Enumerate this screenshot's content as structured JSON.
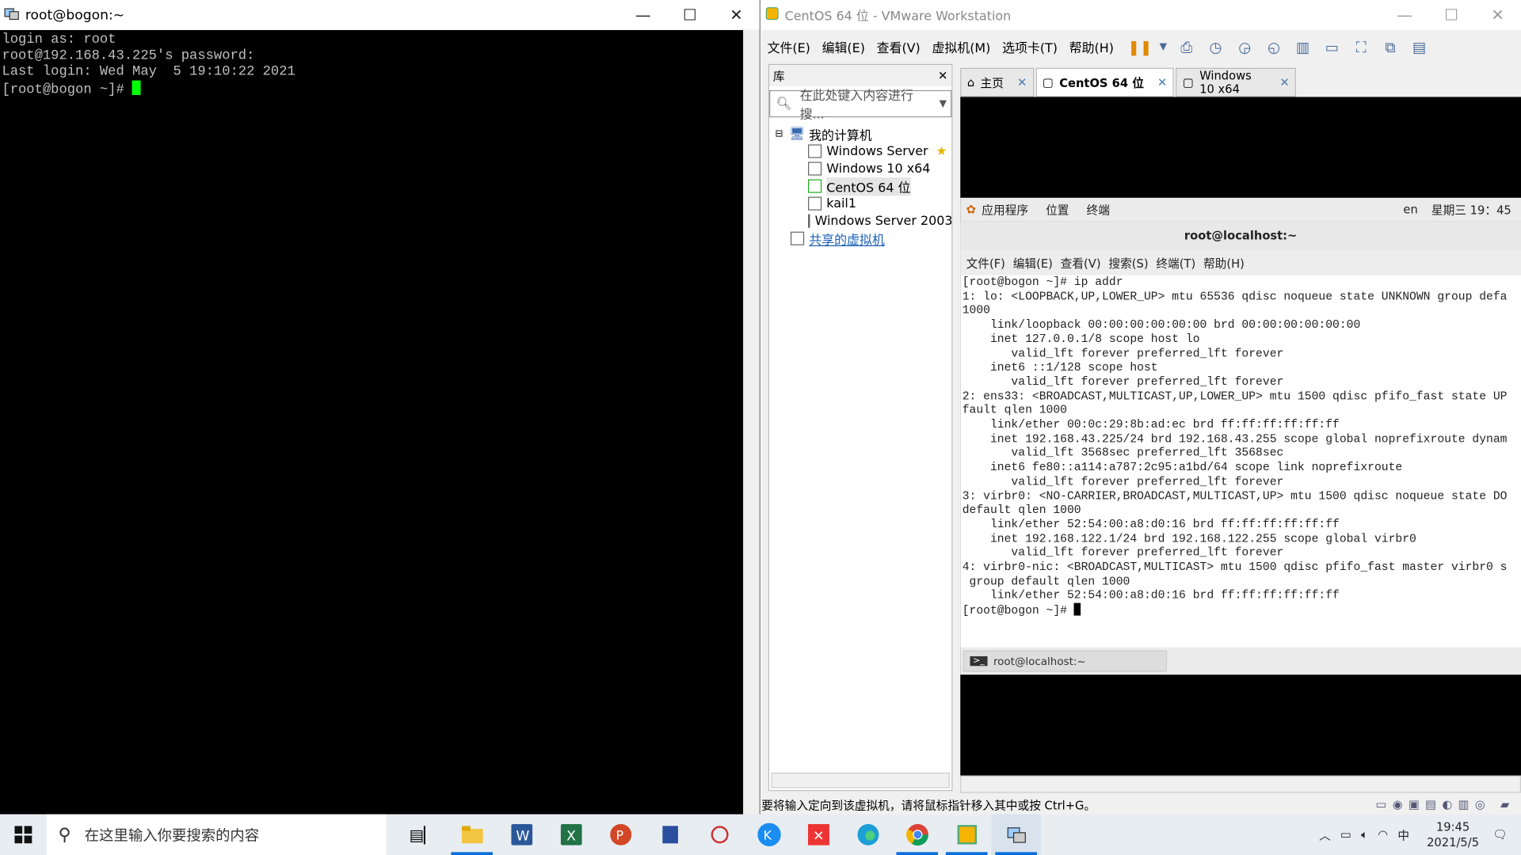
{
  "putty": {
    "title": "root@bogon:~",
    "lines": [
      "login as: root",
      "root@192.168.43.225's password:",
      "Last login: Wed May  5 19:10:22 2021"
    ],
    "prompt": "[root@bogon ~]# "
  },
  "vmware": {
    "title": "CentOS 64 位 - VMware Workstation",
    "menu": [
      "文件(E)",
      "编辑(E)",
      "查看(V)",
      "虚拟机(M)",
      "选项卡(T)",
      "帮助(H)"
    ],
    "library": {
      "header": "库",
      "search_placeholder": "在此处键入内容进行搜...",
      "root": "我的计算机",
      "items": [
        "Windows Server",
        "Windows 10 x64",
        "CentOS 64 位",
        "kail1",
        "Windows Server 2003"
      ],
      "shared": "共享的虚拟机"
    },
    "tabs": [
      "主页",
      "CentOS 64 位",
      "Windows 10 x64"
    ],
    "status": "要将输入定向到该虚拟机，请将鼠标指针移入其中或按 Ctrl+G。"
  },
  "guest": {
    "panel": {
      "apps": "应用程序",
      "places": "位置",
      "terminal": "终端",
      "lang": "en",
      "clock": "星期三 19：45"
    },
    "window_title": "root@localhost:~",
    "menu": [
      "文件(F)",
      "编辑(E)",
      "查看(V)",
      "搜索(S)",
      "终端(T)",
      "帮助(H)"
    ],
    "lines": [
      "[root@bogon ~]# ip addr",
      "1: lo: <LOOPBACK,UP,LOWER_UP> mtu 65536 qdisc noqueue state UNKNOWN group defa",
      "1000",
      "    link/loopback 00:00:00:00:00:00 brd 00:00:00:00:00:00",
      "    inet 127.0.0.1/8 scope host lo",
      "       valid_lft forever preferred_lft forever",
      "    inet6 ::1/128 scope host",
      "       valid_lft forever preferred_lft forever",
      "2: ens33: <BROADCAST,MULTICAST,UP,LOWER_UP> mtu 1500 qdisc pfifo_fast state UP",
      "fault qlen 1000",
      "    link/ether 00:0c:29:8b:ad:ec brd ff:ff:ff:ff:ff:ff",
      "    inet 192.168.43.225/24 brd 192.168.43.255 scope global noprefixroute dynam",
      "       valid_lft 3568sec preferred_lft 3568sec",
      "    inet6 fe80::a114:a787:2c95:a1bd/64 scope link noprefixroute",
      "       valid_lft forever preferred_lft forever",
      "3: virbr0: <NO-CARRIER,BROADCAST,MULTICAST,UP> mtu 1500 qdisc noqueue state DO",
      "default qlen 1000",
      "    link/ether 52:54:00:a8:d0:16 brd ff:ff:ff:ff:ff:ff",
      "    inet 192.168.122.1/24 brd 192.168.122.255 scope global virbr0",
      "       valid_lft forever preferred_lft forever",
      "4: virbr0-nic: <BROADCAST,MULTICAST> mtu 1500 qdisc pfifo_fast master virbr0 s",
      " group default qlen 1000",
      "    link/ether 52:54:00:a8:d0:16 brd ff:ff:ff:ff:ff:ff"
    ],
    "prompt": "[root@bogon ~]# ",
    "task_item": "root@localhost:~"
  },
  "taskbar": {
    "search": "在这里输入你要搜索的内容",
    "time": "19:45",
    "date": "2021/5/5",
    "ime": "中",
    "accent": "#0a6fd8"
  }
}
